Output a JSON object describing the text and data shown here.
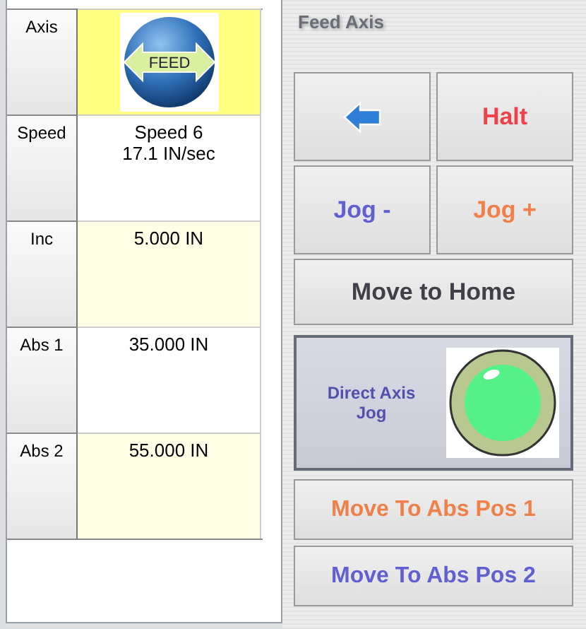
{
  "table": {
    "rows": [
      {
        "label": "Axis",
        "kind": "badge",
        "value": "FEED",
        "shaded": true
      },
      {
        "label": "Speed",
        "kind": "text",
        "value": "Speed 6\n17.1 IN/sec",
        "shaded": false
      },
      {
        "label": "Inc",
        "kind": "text",
        "value": "5.000 IN",
        "shaded": true
      },
      {
        "label": "Abs 1",
        "kind": "text",
        "value": "35.000 IN",
        "shaded": false
      },
      {
        "label": "Abs 2",
        "kind": "text",
        "value": "55.000 IN",
        "shaded": true
      }
    ]
  },
  "panel": {
    "title": "Feed Axis",
    "buttons": [
      {
        "kind": "back",
        "wide": false,
        "color": "#2f7fd8"
      },
      {
        "kind": "text",
        "label": "Halt",
        "wide": false,
        "color": "#f0404a"
      },
      {
        "kind": "text",
        "label": "Jog -",
        "wide": false,
        "color": "#6060d0"
      },
      {
        "kind": "text",
        "label": "Jog +",
        "wide": false,
        "color": "#f0804a"
      },
      {
        "kind": "text",
        "label": "Move to Home",
        "wide": true,
        "color": "#404048"
      }
    ],
    "toggle": {
      "label": "Direct Axis Jog",
      "pressed": true,
      "lamp_on": true
    },
    "moves": [
      {
        "label": "Move To Abs Pos 1",
        "color": "#f0804a"
      },
      {
        "label": "Move To Abs Pos 2",
        "color": "#6060d0"
      }
    ]
  }
}
